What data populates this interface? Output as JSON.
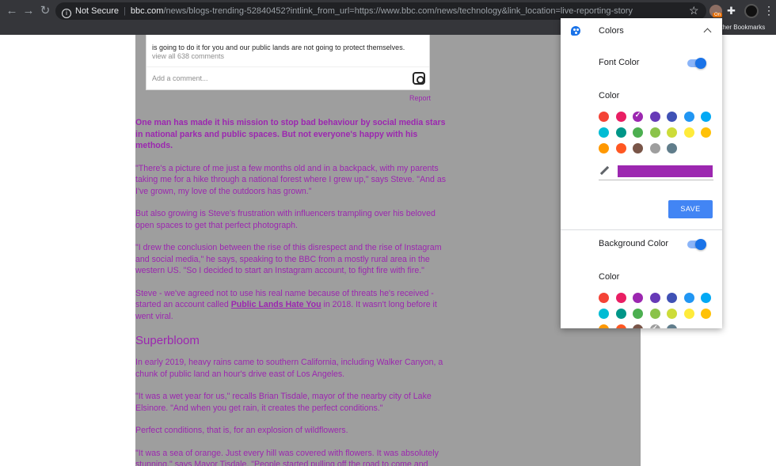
{
  "browser": {
    "security_label": "Not Secure",
    "url_host": "bbc.com",
    "url_path": "/news/blogs-trending-52840452?intlink_from_url=https://www.bbc.com/news/technology&link_location=live-reporting-story",
    "bookmarks_other": "Other Bookmarks",
    "extension_badge": "On"
  },
  "instagram": {
    "caption_fragment": "is going to do it for you and our public lands are not going to protect themselves.",
    "view_comments": "view all 638 comments",
    "add_comment_placeholder": "Add a comment...",
    "report_link": "Report"
  },
  "article": {
    "lead": "One man has made it his mission to stop bad behaviour by social media stars in national parks and public spaces. But not everyone's happy with his methods.",
    "p1": "\"There's a picture of me just a few months old and in a backpack, with my parents taking me for a hike through a national forest where I grew up,\" says Steve. \"And as I've grown, my love of the outdoors has grown.\"",
    "p2": "But also growing is Steve's frustration with influencers trampling over his beloved open spaces to get that perfect photograph.",
    "p3": "\"I drew the conclusion between the rise of this disrespect and the rise of Instagram and social media,\" he says, speaking to the BBC from a mostly rural area in the western US. \"So I decided to start an Instagram account, to fight fire with fire.\"",
    "p4_before": "Steve - we've agreed not to use his real name because of threats he's received - started an account called ",
    "p4_link": "Public Lands Hate You",
    "p4_after": " in 2018. It wasn't long before it went viral.",
    "heading": "Superbloom",
    "p5": "In early 2019, heavy rains came to southern California, including Walker Canyon, a chunk of public land an hour's drive east of Los Angeles.",
    "p6": "\"It was a wet year for us,\" recalls Brian Tisdale, mayor of the nearby city of Lake Elsinore. \"And when you get rain, it creates the perfect conditions.\"",
    "p7": "Perfect conditions, that is, for an explosion of wildflowers.",
    "p8": "\"It was a sea of orange. Just every hill was covered with flowers. It was absolutely stunning,\" says Mayor Tisdale. \"People started pulling off the road to come and"
  },
  "popup": {
    "title": "Colors",
    "font_color_label": "Font Color",
    "font_color_enabled": true,
    "color_label": "Color",
    "selected_color": "#9c27b0",
    "save_label": "SAVE",
    "background_color_label": "Background Color",
    "background_color_enabled": true,
    "background_color_label2": "Color",
    "palette": [
      "#f44336",
      "#e91e63",
      "#9c27b0",
      "#673ab7",
      "#3f51b5",
      "#2196f3",
      "#03a9f4",
      "#00bcd4",
      "#009688",
      "#4caf50",
      "#8bc34a",
      "#cddc39",
      "#ffeb3b",
      "#ffc107",
      "#ff9800",
      "#ff5722",
      "#795548",
      "#9e9e9e",
      "#607d8b"
    ]
  }
}
